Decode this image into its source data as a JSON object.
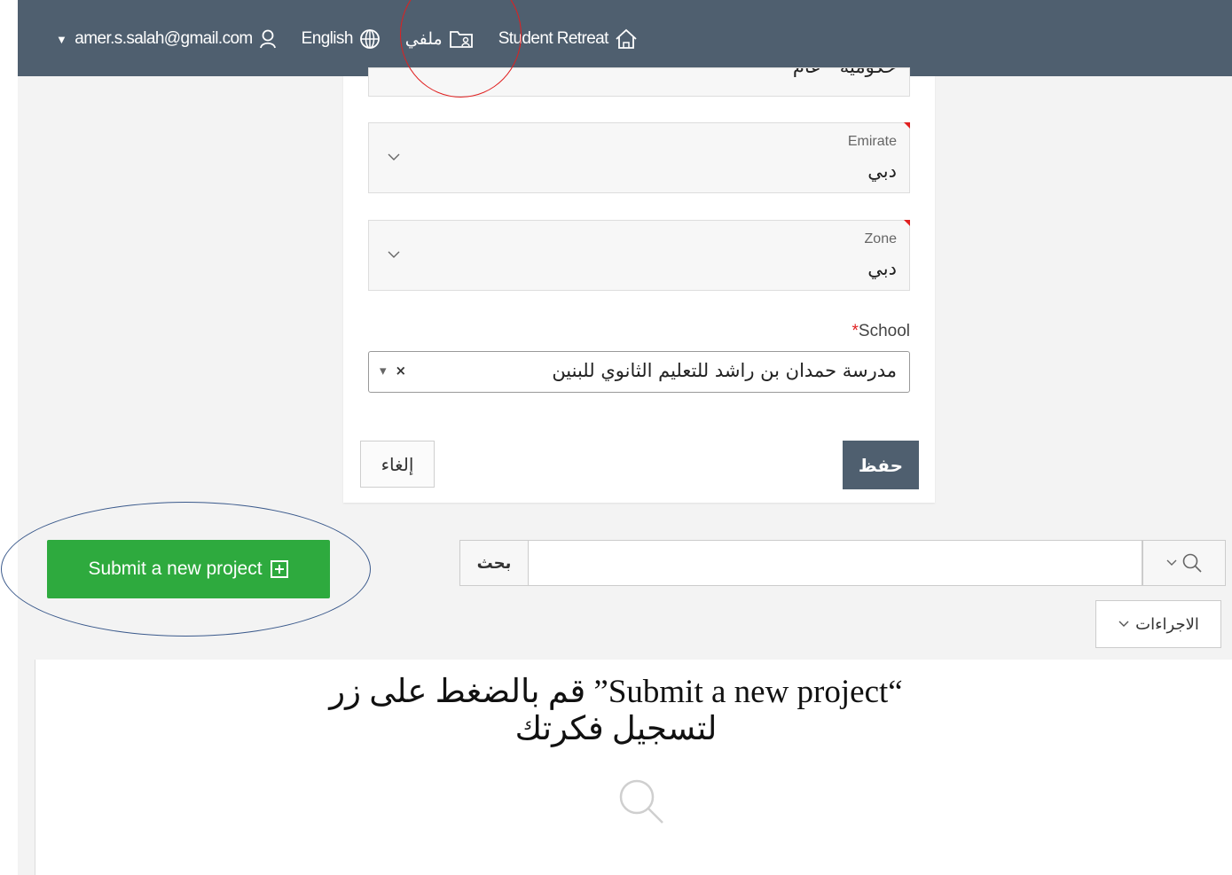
{
  "nav": {
    "account": "amer.s.salah@gmail.com",
    "language": "English",
    "profile": "ملفي",
    "home": "Student Retreat"
  },
  "form": {
    "top_field_value": "حكومية - عام",
    "emirate": {
      "label": "Emirate",
      "value": "دبي"
    },
    "zone": {
      "label": "Zone",
      "value": "دبي"
    },
    "school": {
      "label": "School",
      "required_mark": "*",
      "value": "مدرسة حمدان بن راشد للتعليم الثانوي للبنين"
    },
    "cancel_label": "إلغاء",
    "save_label": "حفظ"
  },
  "submit_button": {
    "label": "Submit a new project"
  },
  "search": {
    "button_label": "بحث",
    "placeholder": ""
  },
  "actions": {
    "label": "الاجراءات"
  },
  "instruction": {
    "line1": "قم بالضغط على زر  ”Submit a new project“",
    "line2": "لتسجيل فكرتك"
  },
  "colors": {
    "nav_bg": "#4f5f6f",
    "submit_green": "#2eaa3e",
    "required_red": "#e02020",
    "annotation_blue": "#3b5a8c"
  }
}
